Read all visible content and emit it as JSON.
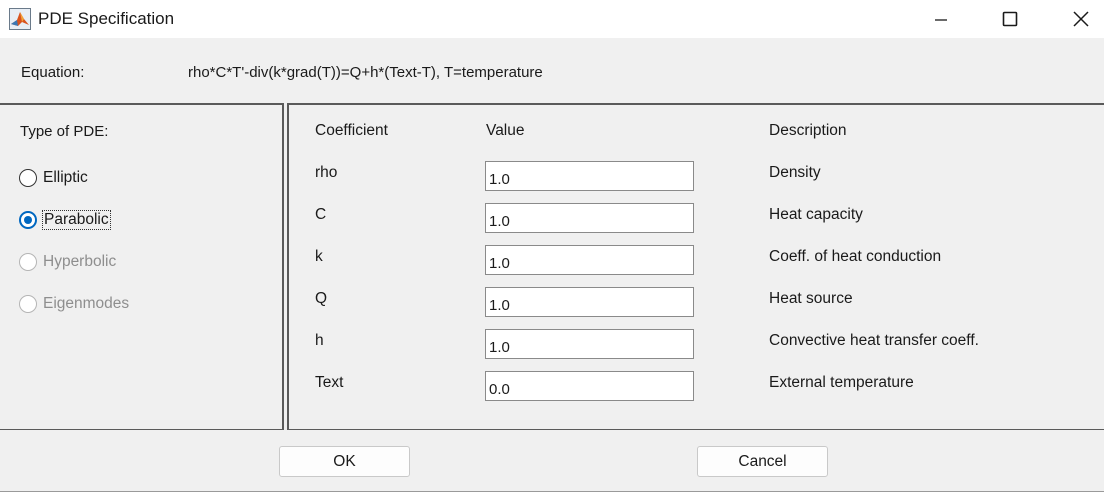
{
  "window": {
    "title": "PDE Specification",
    "app_icon": "matlab-icon"
  },
  "equation": {
    "label": "Equation:",
    "text": "rho*C*T'-div(k*grad(T))=Q+h*(Text-T), T=temperature"
  },
  "pde_type": {
    "label": "Type of PDE:",
    "options": [
      {
        "label": "Elliptic",
        "selected": false,
        "enabled": true
      },
      {
        "label": "Parabolic",
        "selected": true,
        "enabled": true
      },
      {
        "label": "Hyperbolic",
        "selected": false,
        "enabled": false
      },
      {
        "label": "Eigenmodes",
        "selected": false,
        "enabled": false
      }
    ]
  },
  "table": {
    "headers": {
      "coefficient": "Coefficient",
      "value": "Value",
      "description": "Description"
    },
    "rows": [
      {
        "name": "rho",
        "value": "1.0",
        "description": "Density"
      },
      {
        "name": "C",
        "value": "1.0",
        "description": "Heat capacity"
      },
      {
        "name": "k",
        "value": "1.0",
        "description": "Coeff. of heat conduction"
      },
      {
        "name": "Q",
        "value": "1.0",
        "description": "Heat source"
      },
      {
        "name": "h",
        "value": "1.0",
        "description": "Convective heat transfer coeff."
      },
      {
        "name": "Text",
        "value": "0.0",
        "description": "External temperature"
      }
    ]
  },
  "buttons": {
    "ok": "OK",
    "cancel": "Cancel"
  },
  "colors": {
    "accent": "#0067c0",
    "background": "#f0f0f0"
  }
}
